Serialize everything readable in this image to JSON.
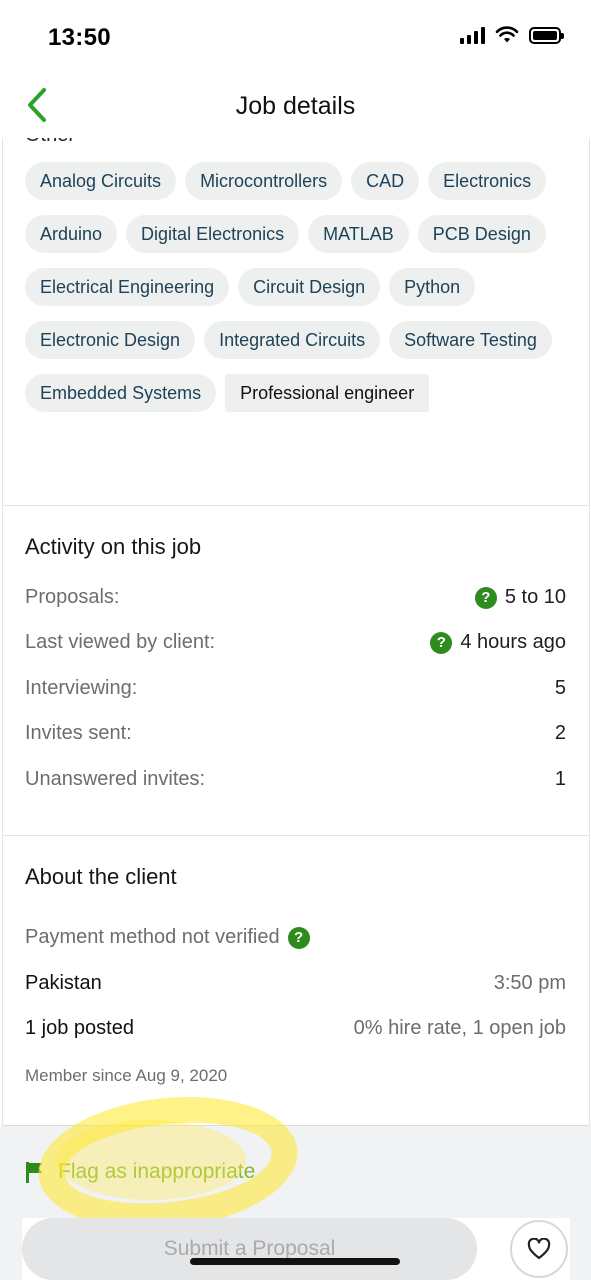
{
  "status_bar": {
    "time": "13:50"
  },
  "header": {
    "title": "Job details"
  },
  "skills": {
    "cut_label": "Other",
    "chips": [
      "Analog Circuits",
      "Microcontrollers",
      "CAD",
      "Electronics",
      "Arduino",
      "Digital Electronics",
      "MATLAB",
      "PCB Design",
      "Electrical Engineering",
      "Circuit Design",
      "Python",
      "Electronic Design",
      "Integrated Circuits",
      "Software Testing",
      "Embedded Systems",
      "Professional engineer"
    ]
  },
  "activity": {
    "title": "Activity on this job",
    "rows": [
      {
        "label": "Proposals:",
        "value": "5 to 10",
        "help": true
      },
      {
        "label": "Last viewed by client:",
        "value": "4 hours ago",
        "help": true
      },
      {
        "label": "Interviewing:",
        "value": "5",
        "help": false
      },
      {
        "label": "Invites sent:",
        "value": "2",
        "help": false
      },
      {
        "label": "Unanswered invites:",
        "value": "1",
        "help": false
      }
    ]
  },
  "client": {
    "title": "About the client",
    "payment": "Payment method not verified",
    "country": "Pakistan",
    "local_time": "3:50 pm",
    "jobs_posted": "1 job posted",
    "hire_stats": "0% hire rate, 1 open job",
    "member_since": "Member since Aug 9, 2020"
  },
  "actions": {
    "flag_label": "Flag as inappropriate",
    "submit_label": "Submit a Proposal"
  },
  "colors": {
    "accent_green": "#2e8b1e",
    "flag_green": "#89b82e",
    "chip_bg": "#eef0f0",
    "chip_text": "#1e4258",
    "highlight_yellow": "#ffe828"
  }
}
